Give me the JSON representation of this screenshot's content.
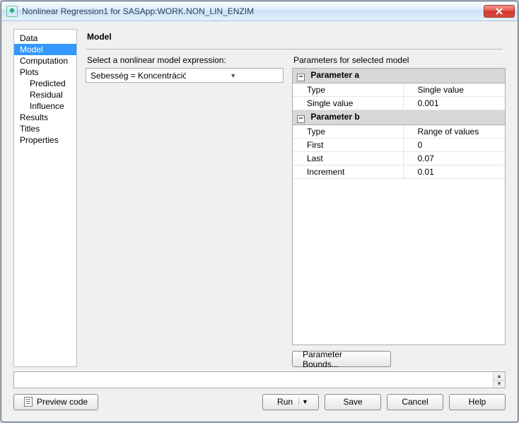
{
  "title": "Nonlinear Regression1 for SASApp:WORK.NON_LIN_ENZIM",
  "nav": {
    "data": "Data",
    "model": "Model",
    "computation": "Computation",
    "plots": "Plots",
    "predicted": "Predicted",
    "residual": "Residual",
    "influence": "Influence",
    "results": "Results",
    "titles": "Titles",
    "properties": "Properties"
  },
  "heading": "Model",
  "model_expr_label": "Select a nonlinear model expression:",
  "model_expr_value": "Sebesség = Koncentráció / ( a + b * Koncentráció )",
  "params_label": "Parameters for selected model",
  "param_a": {
    "title": "Parameter a",
    "type_lbl": "Type",
    "type_val": "Single value",
    "single_lbl": "Single value",
    "single_val": "0.001"
  },
  "param_b": {
    "title": "Parameter b",
    "type_lbl": "Type",
    "type_val": "Range of values",
    "first_lbl": "First",
    "first_val": "0",
    "last_lbl": "Last",
    "last_val": "0.07",
    "incr_lbl": "Increment",
    "incr_val": "0.01"
  },
  "param_bounds_btn": "Parameter Bounds...",
  "preview_btn": "Preview code",
  "run_btn": "Run",
  "save_btn": "Save",
  "cancel_btn": "Cancel",
  "help_btn": "Help"
}
